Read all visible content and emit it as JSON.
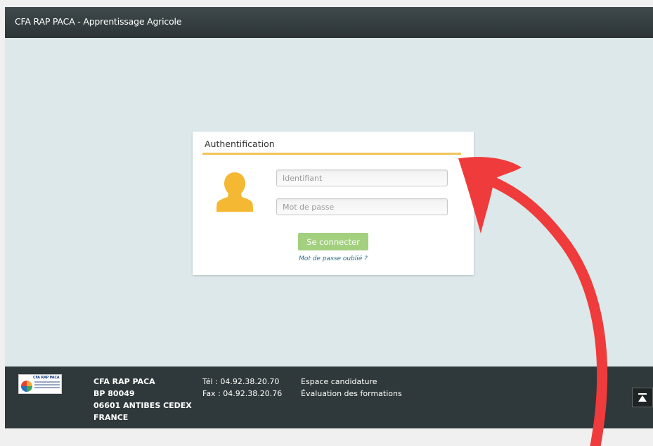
{
  "header": {
    "title": "CFA RAP PACA - Apprentissage Agricole"
  },
  "login": {
    "title": "Authentification",
    "username_placeholder": "Identifiant",
    "password_placeholder": "Mot de passe",
    "submit_label": "Se connecter",
    "forgot_label": "Mot de passe oublié ?",
    "icon": "user-avatar-icon"
  },
  "footer": {
    "logo_text": "CFA RAP PACA",
    "address": {
      "name": "CFA RAP PACA",
      "po_box": "BP 80049",
      "city": "06601 ANTIBES CEDEX",
      "country": "FRANCE"
    },
    "contact": {
      "phone": "Tél : 04.92.38.20.70",
      "fax": "Fax : 04.92.38.20.76"
    },
    "links": [
      {
        "label": "Espace candidature"
      },
      {
        "label": "Évaluation des formations"
      }
    ],
    "scroll_top_icon": "arrow-up-to-top-icon"
  },
  "colors": {
    "header_bg": "#333b3d",
    "page_bg": "#dce8e9",
    "accent_rule": "#f2c45a",
    "button": "#a3d07f",
    "avatar": "#f5b833",
    "link": "#2b6f8a",
    "annotation_arrow": "#ef3b3b"
  }
}
